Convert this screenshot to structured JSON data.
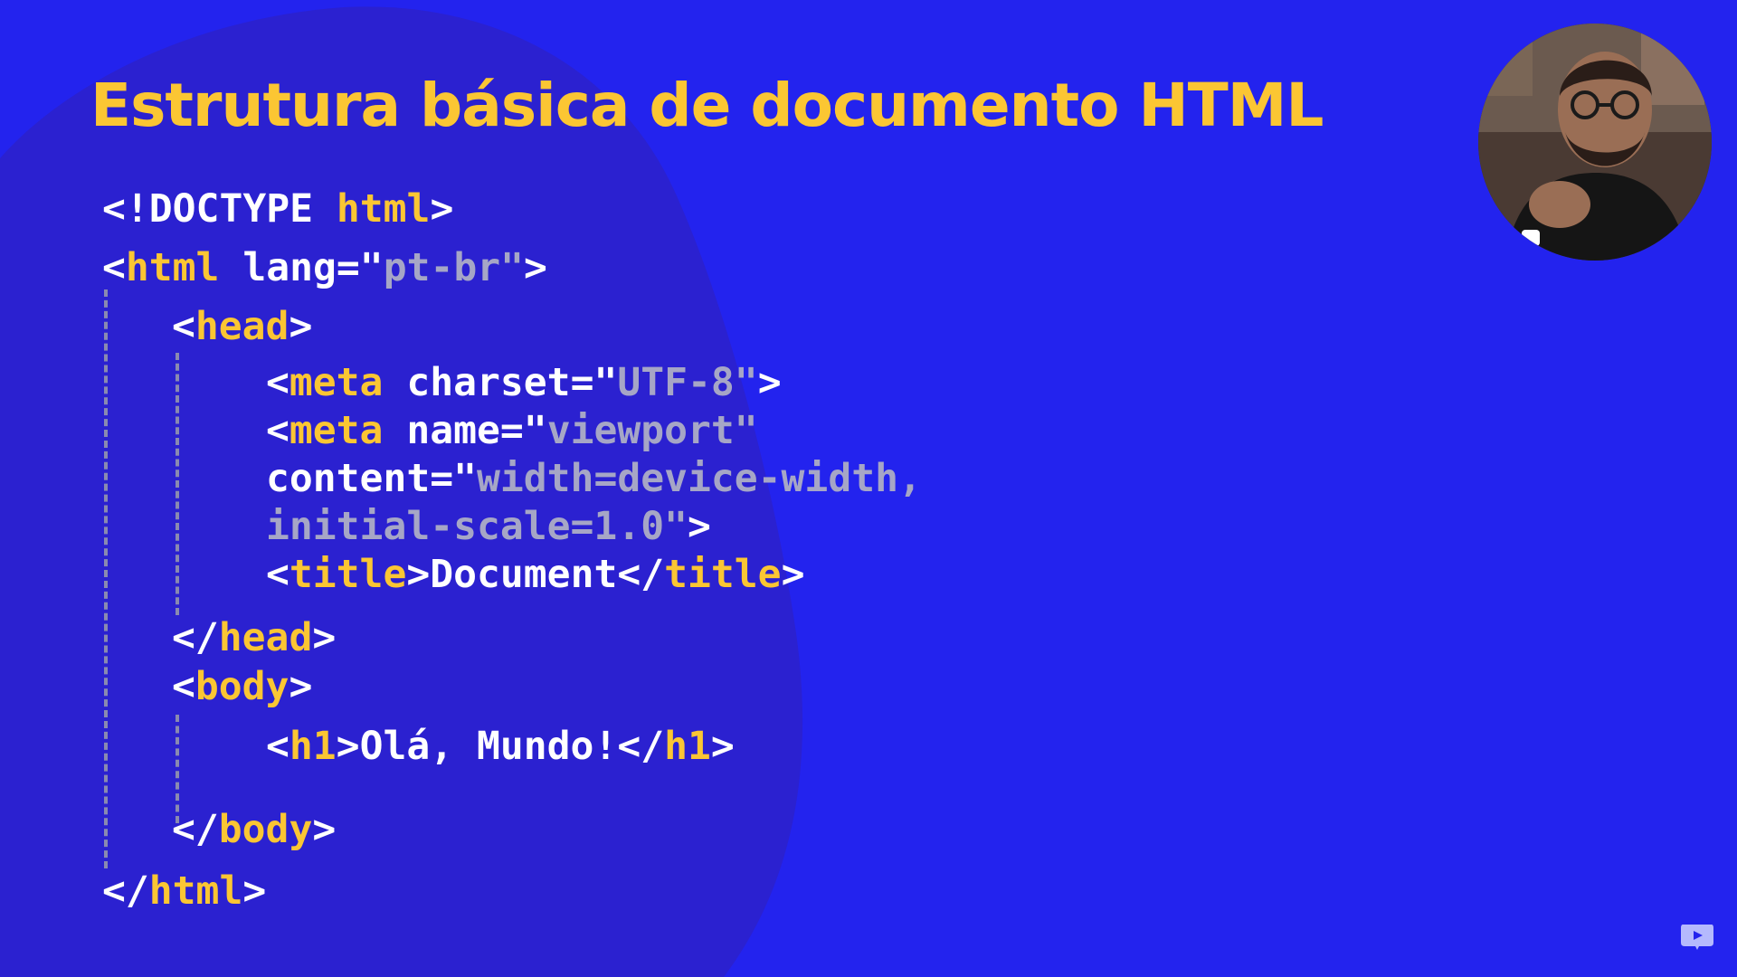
{
  "slide": {
    "title": "Estrutura básica de documento HTML"
  },
  "code": {
    "doctype": "<!DOCTYPE ",
    "doctype_kw": "html",
    "gt": ">",
    "lt": "<",
    "lt_slash": "</",
    "eq_quote": "=\"",
    "quote": "\"",
    "html_tag": "html",
    "lang_attr": " lang",
    "lang_val": "pt-br",
    "head_tag": "head",
    "meta_tag": "meta",
    "charset_attr": " charset",
    "charset_val": "UTF-8",
    "name_attr": " name",
    "name_val": "viewport",
    "content_attr": "content",
    "content_val_1": "width=device-width,",
    "content_val_2": "initial-scale=1.0",
    "title_tag": "title",
    "title_text": "Document",
    "body_tag": "body",
    "h1_tag": "h1",
    "h1_text": "Olá, Mundo!"
  },
  "colors": {
    "background": "#2323ee",
    "blob": "#2b21d0",
    "tag": "#fbc633",
    "string": "#a6a6c6",
    "text": "#ffffff"
  },
  "icons": {
    "presenter": "presenter-webcam",
    "logo": "channel-logo-icon"
  }
}
